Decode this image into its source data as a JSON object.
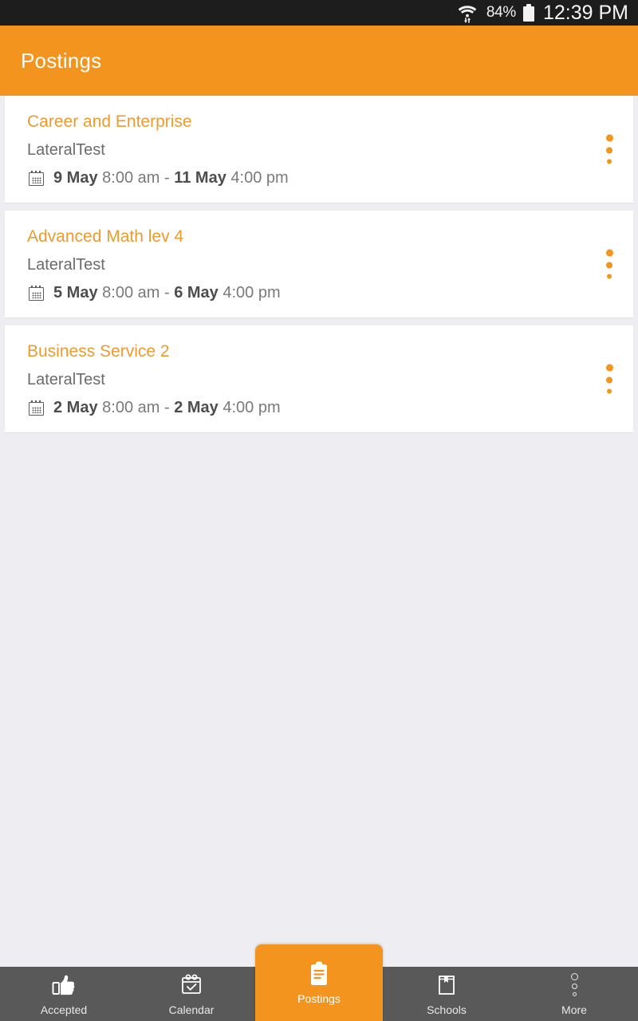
{
  "status_bar": {
    "wifi_icon": "wifi-data-icon",
    "battery_percent": "84%",
    "battery_icon": "battery-icon",
    "time": "12:39 PM"
  },
  "header": {
    "title": "Postings"
  },
  "colors": {
    "accent": "#f2941d",
    "title_text": "#ed9a2e",
    "nav_bg": "#595959",
    "page_bg": "#eeeef2",
    "card_bg": "#ffffff"
  },
  "postings": [
    {
      "title": "Career and Enterprise",
      "organisation": "LateralTest",
      "calendar_icon": "calendar-icon",
      "start_date": "9 May",
      "start_time": "8:00 am",
      "separator": "-",
      "end_date": "11 May",
      "end_time": "4:00 pm",
      "menu_icon": "overflow-menu-icon"
    },
    {
      "title": "Advanced Math lev 4",
      "organisation": "LateralTest",
      "calendar_icon": "calendar-icon",
      "start_date": "5 May",
      "start_time": "8:00 am",
      "separator": "-",
      "end_date": "6 May",
      "end_time": "4:00 pm",
      "menu_icon": "overflow-menu-icon"
    },
    {
      "title": "Business Service 2",
      "organisation": "LateralTest",
      "calendar_icon": "calendar-icon",
      "start_date": "2 May",
      "start_time": "8:00 am",
      "separator": "-",
      "end_date": "2 May",
      "end_time": "4:00 pm",
      "menu_icon": "overflow-menu-icon"
    }
  ],
  "bottom_nav": {
    "active_index": 2,
    "items": [
      {
        "label": "Accepted",
        "icon": "thumbs-up-icon"
      },
      {
        "label": "Calendar",
        "icon": "calendar-check-icon"
      },
      {
        "label": "Postings",
        "icon": "clipboard-icon"
      },
      {
        "label": "Schools",
        "icon": "book-bookmark-icon"
      },
      {
        "label": "More",
        "icon": "more-dots-icon"
      }
    ]
  }
}
